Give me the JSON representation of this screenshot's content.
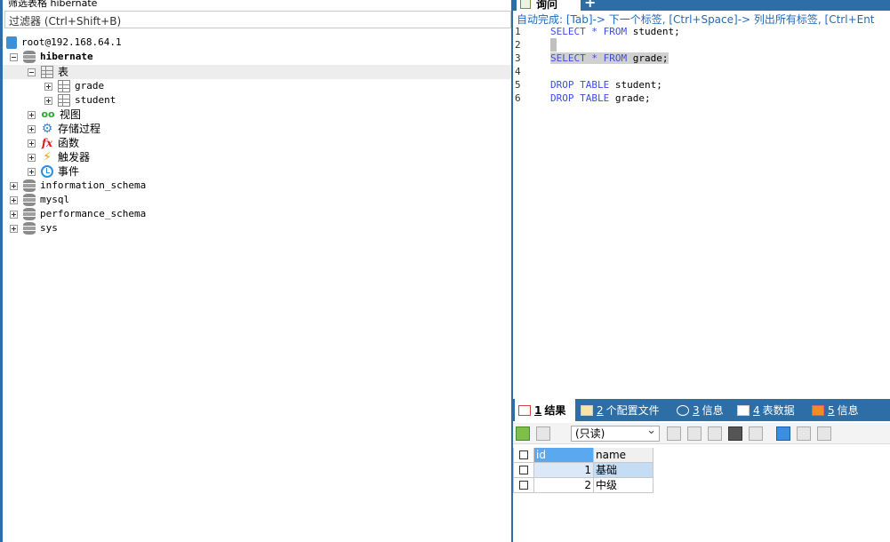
{
  "left": {
    "filter_title": "筛选表格 hibernate",
    "filter_placeholder": "过滤器 (Ctrl+Shift+B)",
    "tree": {
      "connection": "root@192.168.64.1",
      "databases": [
        {
          "name": "hibernate",
          "expanded": true
        },
        {
          "name": "information_schema"
        },
        {
          "name": "mysql"
        },
        {
          "name": "performance_schema"
        },
        {
          "name": "sys"
        }
      ],
      "hibernate_children": {
        "tables_label": "表",
        "tables": [
          "grade",
          "student"
        ],
        "views_label": "视图",
        "procs_label": "存储过程",
        "funcs_label": "函数",
        "triggers_label": "触发器",
        "events_label": "事件"
      }
    }
  },
  "right": {
    "query_tab_label": "询问",
    "add_tab_label": "+",
    "autocomplete_hint": "自动完成: [Tab]-> 下一个标签, [Ctrl+Space]-> 列出所有标签, [Ctrl+Ent",
    "editor": {
      "line_numbers": [
        "1",
        "2",
        "3",
        "4",
        "5",
        "6"
      ],
      "lines": [
        {
          "kw1": "SELECT",
          "op": "*",
          "kw2": "FROM",
          "rest": "student;"
        },
        {},
        {
          "kw1": "SELECT",
          "op": "*",
          "kw2": "FROM",
          "rest": "grade;"
        },
        {},
        {
          "kw1": "DROP TABLE",
          "rest": "student;"
        },
        {
          "kw1": "DROP TABLE",
          "rest": "grade;"
        }
      ]
    },
    "result_tabs": [
      {
        "num": "1",
        "label": "结果"
      },
      {
        "num": "2",
        "label": "个配置文件"
      },
      {
        "num": "3",
        "label": "信息"
      },
      {
        "num": "4",
        "label": "表数据"
      },
      {
        "num": "5",
        "label": "信息"
      }
    ],
    "toolbar": {
      "readonly_select": "(只读)"
    },
    "grid": {
      "columns": [
        "id",
        "name"
      ],
      "rows": [
        {
          "id": "1",
          "name": "基础"
        },
        {
          "id": "2",
          "name": "中级"
        }
      ]
    }
  },
  "colors": {
    "accent": "#2d6ea6",
    "keyword": "#3b4fe0",
    "hint": "#1f6bbf"
  }
}
